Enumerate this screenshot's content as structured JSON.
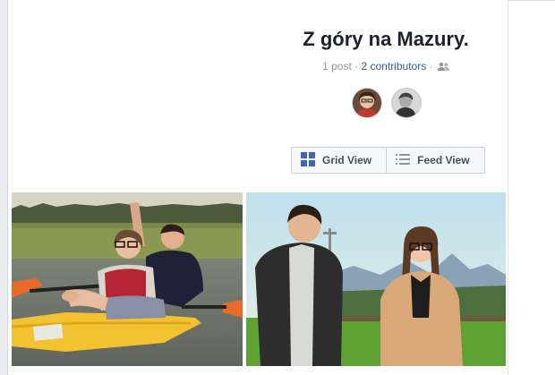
{
  "album": {
    "title": "Z góry na Mazury.",
    "posts": "1 post",
    "separator": " · ",
    "contributors": "2 contributors",
    "contributors_icon": "people-icon"
  },
  "avatars": [
    {
      "name": "contributor-avatar-1"
    },
    {
      "name": "contributor-avatar-2"
    }
  ],
  "view_switch": {
    "grid_label": "Grid View",
    "feed_label": "Feed View",
    "grid_icon": "grid-icon",
    "feed_icon": "list-icon",
    "accent": "#4267b2"
  },
  "photos": [
    {
      "name": "album-photo-kayak"
    },
    {
      "name": "album-photo-couple-mountains"
    }
  ]
}
